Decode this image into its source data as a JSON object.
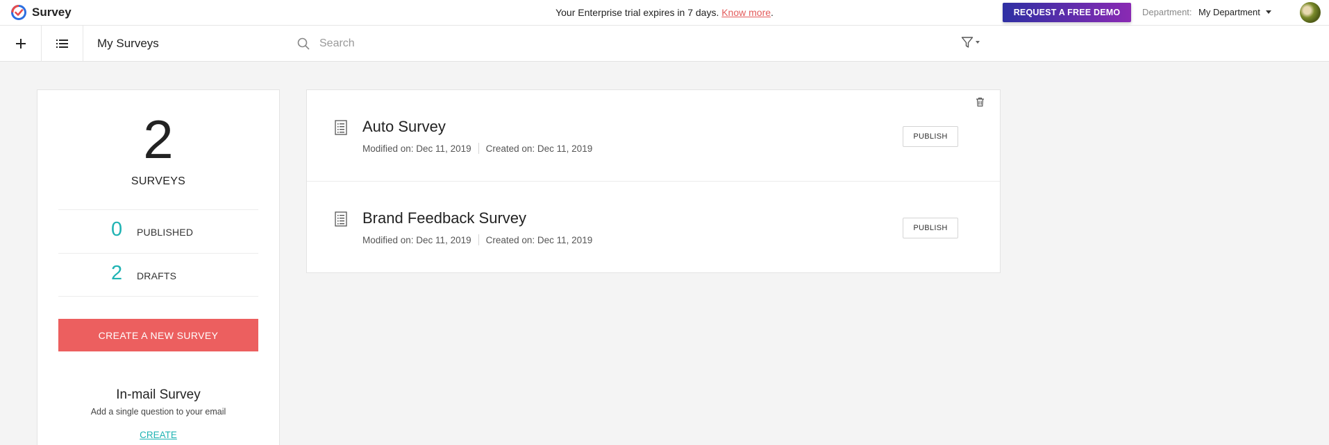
{
  "app": {
    "name": "Survey"
  },
  "banner": {
    "trial_text": "Your Enterprise trial expires in 7 days.",
    "trial_link": "Know more",
    "trial_period": ".",
    "demo_button": "REQUEST A FREE DEMO",
    "department_label": "Department:",
    "department_value": "My Department"
  },
  "toolbar": {
    "title": "My Surveys",
    "search_placeholder": "Search"
  },
  "stats": {
    "total": "2",
    "total_label": "SURVEYS",
    "published_count": "0",
    "published_label": "PUBLISHED",
    "drafts_count": "2",
    "drafts_label": "DRAFTS",
    "create_button": "CREATE A NEW SURVEY",
    "inmail_title": "In-mail Survey",
    "inmail_subtitle": "Add a single question to your email",
    "inmail_link": "CREATE"
  },
  "surveys": [
    {
      "title": "Auto Survey",
      "modified": "Modified on: Dec 11, 2019",
      "created": "Created on: Dec 11, 2019",
      "action": "PUBLISH"
    },
    {
      "title": "Brand Feedback Survey",
      "modified": "Modified on: Dec 11, 2019",
      "created": "Created on: Dec 11, 2019",
      "action": "PUBLISH"
    }
  ],
  "colors": {
    "accent_teal": "#1fb3b3",
    "create_red": "#ec5f5f",
    "link_red": "#e35b5b",
    "demo_gradient_start": "#2e2fa3",
    "demo_gradient_end": "#8a2ab3"
  },
  "icons": {
    "logo": "survey-logo-icon",
    "plus": "plus-icon",
    "list": "list-view-icon",
    "search": "search-icon",
    "filter": "filter-icon",
    "trash": "trash-icon",
    "document": "survey-document-icon"
  }
}
